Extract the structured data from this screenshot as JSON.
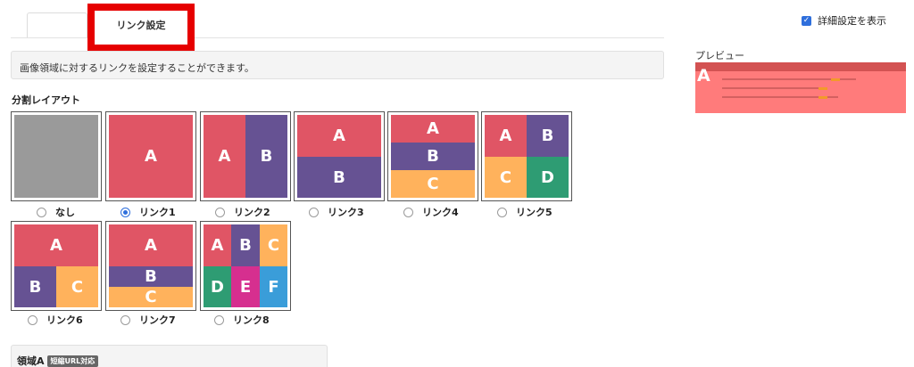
{
  "tabs": {
    "active_label": "リンク設定"
  },
  "advanced_toggle": {
    "label": "詳細設定を表示",
    "checked": true
  },
  "info_text": "画像領域に対するリンクを設定することができます。",
  "preview": {
    "label": "プレビュー",
    "region_letter": "A"
  },
  "section_title": "分割レイアウト",
  "layouts": {
    "none": {
      "label": "なし",
      "selected": false
    },
    "link1": {
      "label": "リンク1",
      "selected": true,
      "cells": [
        "A"
      ]
    },
    "link2": {
      "label": "リンク2",
      "selected": false,
      "cells": [
        "A",
        "B"
      ]
    },
    "link3": {
      "label": "リンク3",
      "selected": false,
      "cells": [
        "A",
        "B"
      ]
    },
    "link4": {
      "label": "リンク4",
      "selected": false,
      "cells": [
        "A",
        "B",
        "C"
      ]
    },
    "link5": {
      "label": "リンク5",
      "selected": false,
      "cells": [
        "A",
        "B",
        "C",
        "D"
      ]
    },
    "link6": {
      "label": "リンク6",
      "selected": false,
      "cells": [
        "A",
        "B",
        "C"
      ]
    },
    "link7": {
      "label": "リンク7",
      "selected": false,
      "cells": [
        "A",
        "B",
        "C"
      ]
    },
    "link8": {
      "label": "リンク8",
      "selected": false,
      "cells": [
        "A",
        "B",
        "C",
        "D",
        "E",
        "F"
      ]
    }
  },
  "region": {
    "label": "領域A",
    "badge": "短縮URL対応"
  },
  "colors": {
    "red": "#e05565",
    "purple": "#665293",
    "orange": "#ffb25c",
    "green": "#2e9c73",
    "pink": "#d62f8f",
    "blue": "#3a9dd9",
    "gray": "#9a9a9a",
    "highlight": "#e60000",
    "accent": "#2f6fdc"
  }
}
